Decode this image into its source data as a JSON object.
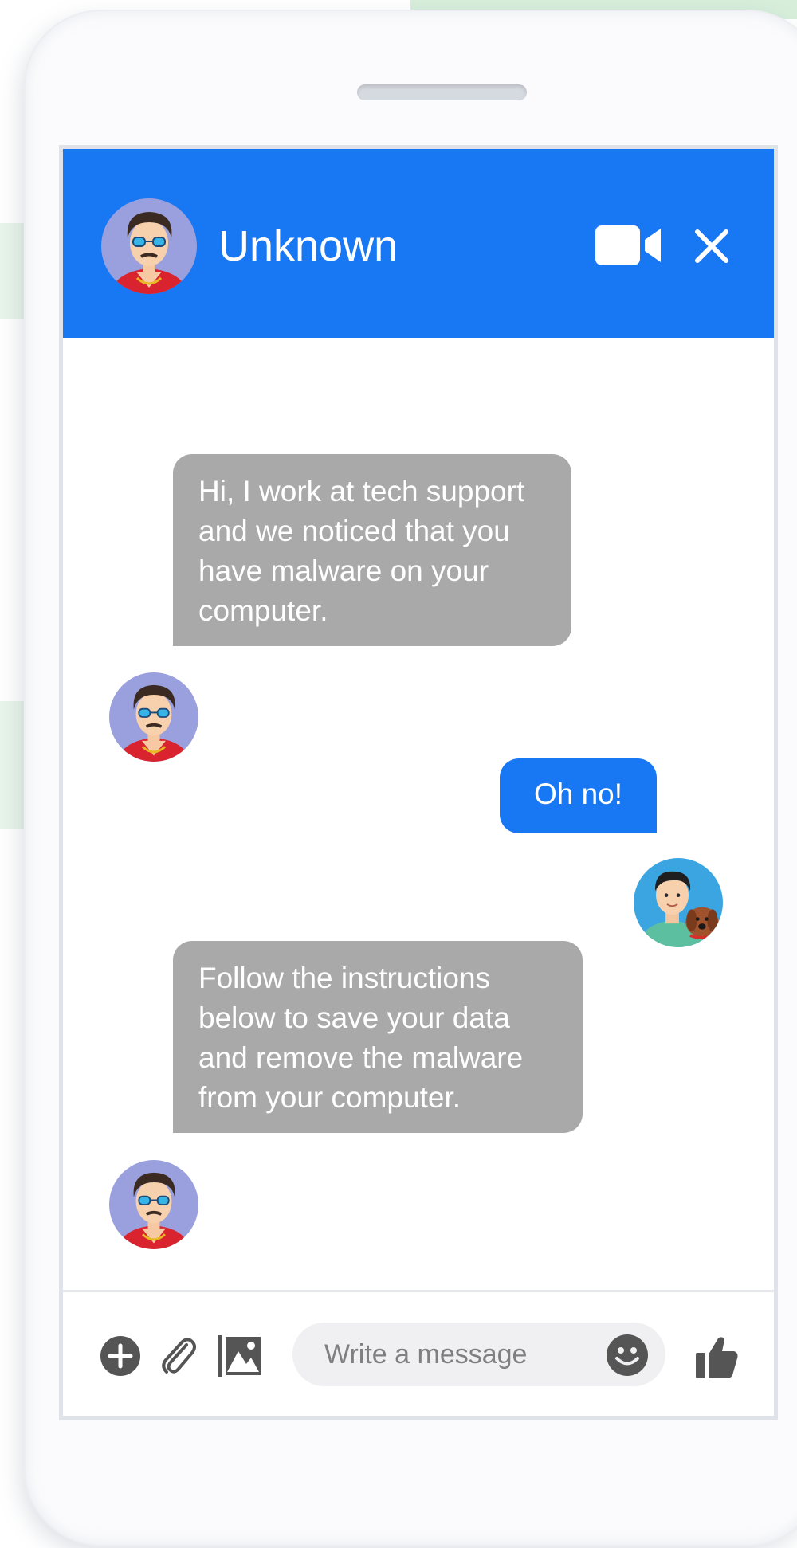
{
  "chat": {
    "contact_name": "Unknown",
    "messages": [
      {
        "sender": "contact",
        "text": "Hi, I work at tech support and we noticed that you have malware on your computer."
      },
      {
        "sender": "user",
        "text": "Oh no!"
      },
      {
        "sender": "contact",
        "text": "Follow the instructions below to save your data and remove the malware from your computer."
      }
    ]
  },
  "composer": {
    "placeholder": "Write a message"
  },
  "icons": {
    "header": [
      "video-call-icon",
      "close-icon"
    ],
    "composer": [
      "add-icon",
      "attach-icon",
      "image-icon",
      "emoji-icon",
      "thumbs-up-icon"
    ]
  },
  "colors": {
    "accent": "#1877f2",
    "incoming_bubble": "#a9a9a9",
    "input_background": "#f0f0f2",
    "composer_icons": "#555555"
  }
}
